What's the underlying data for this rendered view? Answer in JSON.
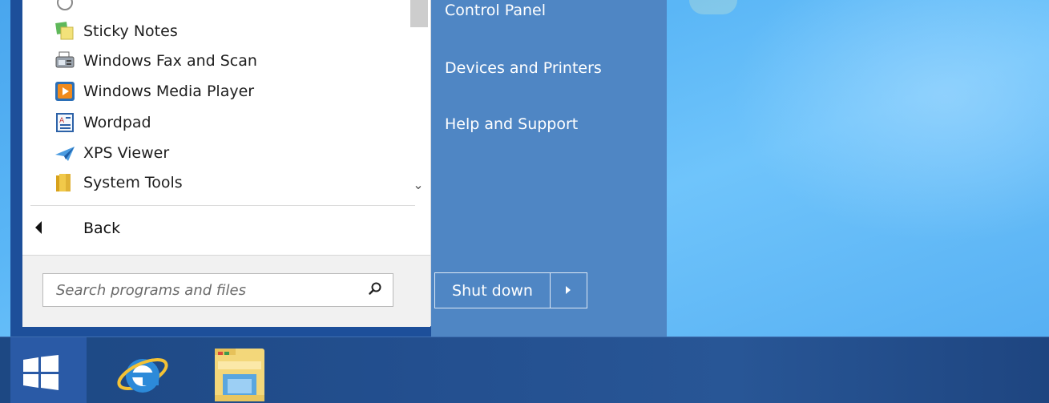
{
  "programs": [
    {
      "label": "Sticky Notes",
      "icon": "sticky-notes-icon"
    },
    {
      "label": "Windows Fax and Scan",
      "icon": "fax-scan-icon"
    },
    {
      "label": "Windows Media Player",
      "icon": "media-player-icon"
    },
    {
      "label": "Wordpad",
      "icon": "wordpad-icon"
    },
    {
      "label": "XPS Viewer",
      "icon": "xps-viewer-icon"
    },
    {
      "label": "System Tools",
      "icon": "folder-icon"
    }
  ],
  "back_label": "Back",
  "search": {
    "placeholder": "Search programs and files"
  },
  "right_links": [
    {
      "label": "Control Panel"
    },
    {
      "label": "Devices and Printers"
    },
    {
      "label": "Help and Support"
    }
  ],
  "shutdown": {
    "label": "Shut down"
  },
  "taskbar": {
    "apps": [
      {
        "name": "internet-explorer-icon"
      },
      {
        "name": "file-explorer-icon"
      }
    ]
  },
  "colors": {
    "start_menu_dark": "#1d4f9a",
    "right_pane": "#4f86c4",
    "taskbar": "#234f8f",
    "desktop": "#5ab6f6"
  }
}
